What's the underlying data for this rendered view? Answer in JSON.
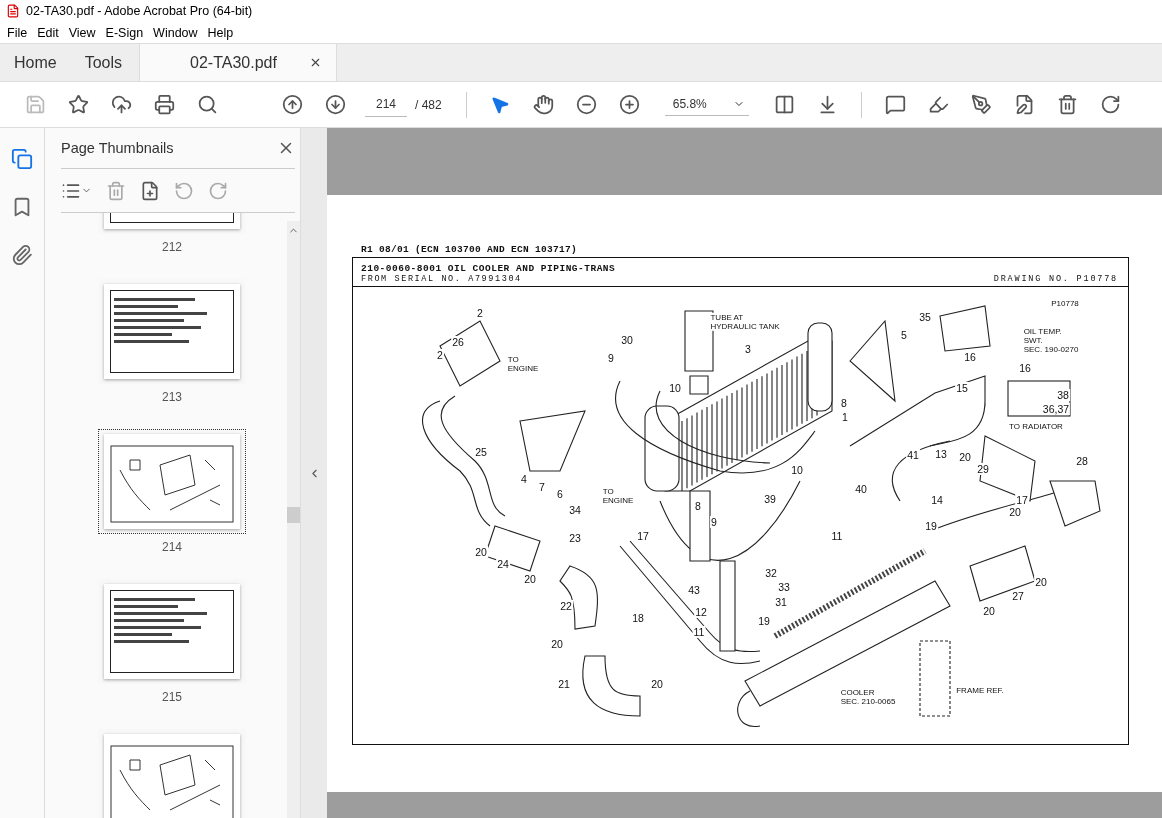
{
  "window": {
    "title": "02-TA30.pdf - Adobe Acrobat Pro (64-bit)"
  },
  "menu": [
    "File",
    "Edit",
    "View",
    "E-Sign",
    "Window",
    "Help"
  ],
  "tabs": [
    {
      "label": "Home",
      "selected": false
    },
    {
      "label": "Tools",
      "selected": false
    },
    {
      "label": "02-TA30.pdf",
      "selected": true
    }
  ],
  "toolbar": {
    "page_current": "214",
    "page_total": "/ 482",
    "zoom": "65.8%"
  },
  "side_panel": {
    "title": "Page Thumbnails",
    "thumbnails": [
      {
        "label": "212",
        "kind": "table",
        "selected": false
      },
      {
        "label": "213",
        "kind": "table",
        "selected": false
      },
      {
        "label": "214",
        "kind": "drawing",
        "selected": true
      },
      {
        "label": "215",
        "kind": "table",
        "selected": false
      },
      {
        "kind": "drawing",
        "selected": false
      }
    ]
  },
  "page": {
    "revision": "R1 08/01 (ECN 103700 AND ECN 103717)",
    "title": "210-0060-8001 OIL COOLER AND PIPING-TRANS",
    "serial": "FROM SERIAL NO. A7991304",
    "drawing_no": "DRAWING NO. P10778",
    "callouts": [
      {
        "text": "2",
        "kind": "number"
      },
      {
        "text": "26",
        "kind": "number"
      },
      {
        "text": "2",
        "kind": "number"
      },
      {
        "text": "TO\nENGINE",
        "kind": "note"
      },
      {
        "text": "30",
        "kind": "number"
      },
      {
        "text": "9",
        "kind": "number"
      },
      {
        "text": "10",
        "kind": "number"
      },
      {
        "text": "TUBE AT\nHYDRAULIC TANK",
        "kind": "note"
      },
      {
        "text": "3",
        "kind": "number"
      },
      {
        "text": "5",
        "kind": "number"
      },
      {
        "text": "35",
        "kind": "number"
      },
      {
        "text": "P10778",
        "kind": "note"
      },
      {
        "text": "OIL TEMP.\nSWT.\nSEC. 190-0270",
        "kind": "note"
      },
      {
        "text": "16",
        "kind": "number"
      },
      {
        "text": "16",
        "kind": "number"
      },
      {
        "text": "15",
        "kind": "number"
      },
      {
        "text": "38",
        "kind": "number"
      },
      {
        "text": "36,37",
        "kind": "number"
      },
      {
        "text": "8",
        "kind": "number"
      },
      {
        "text": "1",
        "kind": "number"
      },
      {
        "text": "TO RADIATOR",
        "kind": "note"
      },
      {
        "text": "25",
        "kind": "number"
      },
      {
        "text": "4",
        "kind": "number"
      },
      {
        "text": "7",
        "kind": "number"
      },
      {
        "text": "6",
        "kind": "number"
      },
      {
        "text": "TO\nENGINE",
        "kind": "note"
      },
      {
        "text": "10",
        "kind": "number"
      },
      {
        "text": "41",
        "kind": "number"
      },
      {
        "text": "13",
        "kind": "number"
      },
      {
        "text": "20",
        "kind": "number"
      },
      {
        "text": "29",
        "kind": "number"
      },
      {
        "text": "28",
        "kind": "number"
      },
      {
        "text": "40",
        "kind": "number"
      },
      {
        "text": "39",
        "kind": "number"
      },
      {
        "text": "14",
        "kind": "number"
      },
      {
        "text": "17",
        "kind": "number"
      },
      {
        "text": "20",
        "kind": "number"
      },
      {
        "text": "8",
        "kind": "number"
      },
      {
        "text": "34",
        "kind": "number"
      },
      {
        "text": "17",
        "kind": "number"
      },
      {
        "text": "9",
        "kind": "number"
      },
      {
        "text": "23",
        "kind": "number"
      },
      {
        "text": "11",
        "kind": "number"
      },
      {
        "text": "19",
        "kind": "number"
      },
      {
        "text": "20",
        "kind": "number"
      },
      {
        "text": "24",
        "kind": "number"
      },
      {
        "text": "20",
        "kind": "number"
      },
      {
        "text": "32",
        "kind": "number"
      },
      {
        "text": "33",
        "kind": "number"
      },
      {
        "text": "31",
        "kind": "number"
      },
      {
        "text": "43",
        "kind": "number"
      },
      {
        "text": "22",
        "kind": "number"
      },
      {
        "text": "12",
        "kind": "number"
      },
      {
        "text": "18",
        "kind": "number"
      },
      {
        "text": "19",
        "kind": "number"
      },
      {
        "text": "20",
        "kind": "number"
      },
      {
        "text": "27",
        "kind": "number"
      },
      {
        "text": "20",
        "kind": "number"
      },
      {
        "text": "11",
        "kind": "number"
      },
      {
        "text": "20",
        "kind": "number"
      },
      {
        "text": "21",
        "kind": "number"
      },
      {
        "text": "20",
        "kind": "number"
      },
      {
        "text": "COOLER\nSEC. 210-0065",
        "kind": "note"
      },
      {
        "text": "FRAME REF.",
        "kind": "note"
      }
    ]
  }
}
